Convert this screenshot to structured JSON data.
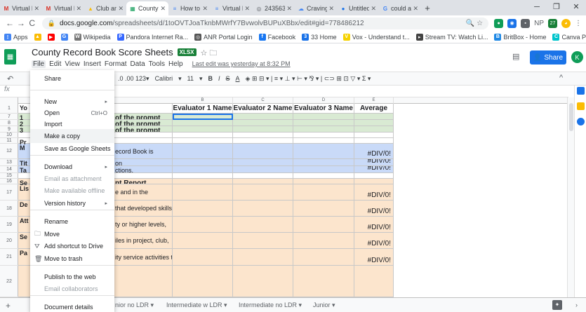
{
  "browser": {
    "tabs": [
      {
        "label": "Virtual R",
        "icon": "gmail-icon",
        "color": "#d93025",
        "glyph": "M"
      },
      {
        "label": "Virtual R",
        "icon": "gmail-icon",
        "color": "#d93025",
        "glyph": "M"
      },
      {
        "label": "Club and",
        "icon": "drive-icon",
        "color": "#fbbc04",
        "glyph": "▲"
      },
      {
        "label": "County R",
        "icon": "sheets-icon",
        "color": "#0f9d58",
        "glyph": "▦",
        "active": true
      },
      {
        "label": "How to",
        "icon": "docs-icon",
        "color": "#4285f4",
        "glyph": "≡"
      },
      {
        "label": "Virtual E",
        "icon": "docs-icon",
        "color": "#4285f4",
        "glyph": "≡"
      },
      {
        "label": "243563.",
        "icon": "globe-icon",
        "color": "#5f6368",
        "glyph": "◎"
      },
      {
        "label": "Craving",
        "icon": "cloud-icon",
        "color": "#4285f4",
        "glyph": "☁"
      },
      {
        "label": "Untitled",
        "icon": "chrome-icon",
        "color": "#1a73e8",
        "glyph": "●"
      },
      {
        "label": "could a",
        "icon": "google-icon",
        "color": "#4285f4",
        "glyph": "G"
      }
    ],
    "url_host": "docs.google.com",
    "url_path": "/spreadsheets/d/1toOVTJoaTknbMWrfY7BvwolvBUPuXBbx/edit#gid=778486212",
    "bookmarks": [
      {
        "label": "Apps",
        "color": "#4285f4",
        "glyph": "⋮"
      },
      {
        "label": "",
        "color": "#fbbc04",
        "glyph": "▲"
      },
      {
        "label": "",
        "color": "#ff0000",
        "glyph": "▶"
      },
      {
        "label": "",
        "color": "#4285f4",
        "glyph": "G"
      },
      {
        "label": "Wikipedia",
        "color": "#777777",
        "glyph": "W"
      },
      {
        "label": "Pandora Internet Ra...",
        "color": "#3668ff",
        "glyph": "P"
      },
      {
        "label": "ANR Portal Login",
        "color": "#555555",
        "glyph": "◎"
      },
      {
        "label": "Facebook",
        "color": "#1877f2",
        "glyph": "f"
      },
      {
        "label": "33 Home",
        "color": "#1a73e8",
        "glyph": "3"
      },
      {
        "label": "Vox - Understand t...",
        "color": "#f5d200",
        "glyph": "V"
      },
      {
        "label": "Stream TV: Watch Li...",
        "color": "#444444",
        "glyph": "▸"
      },
      {
        "label": "BritBox - Home",
        "color": "#1e88e5",
        "glyph": "B"
      },
      {
        "label": "Canva Pro",
        "color": "#00c4cc",
        "glyph": "C"
      }
    ],
    "ext_labels": [
      "NP",
      "27"
    ],
    "more_bookmarks": "»"
  },
  "sheets": {
    "title": "County Record Book Score Sheets",
    "badge": "XLSX",
    "menu": [
      "File",
      "Edit",
      "View",
      "Insert",
      "Format",
      "Data",
      "Tools",
      "Help"
    ],
    "last_edit": "Last edit was yesterday at 8:32 PM",
    "share_label": "Share",
    "avatar": "K"
  },
  "toolbar": {
    "decimals": ".0  .00  123▾",
    "font": "Calibri",
    "font_caret": "▾",
    "size": "11",
    "size_caret": "▾",
    "bold": "B",
    "italic": "I",
    "strike": "S",
    "textcolor": "A",
    "rest": "◈  ⊞  ⊟ ▾  |  ≡ ▾  ⊥ ▾  ⊢ ▾  ⅋ ▾  |  ⊂⊃  ⊞  ⊡  ▽ ▾  Σ ▾"
  },
  "formula": {
    "fx": "fx"
  },
  "grid": {
    "col_letters": [
      "B",
      "C",
      "D",
      "E"
    ],
    "headers": [
      "Evaluator 1 Name",
      "Evaluator 2 Name",
      "Evaluator 3 Name",
      "Average"
    ],
    "row_numbers": [
      "1",
      "7",
      "8",
      "9",
      "10",
      "11",
      "12",
      "13",
      "14",
      "15",
      "16",
      "17",
      "18",
      "19",
      "20",
      "21",
      "22"
    ],
    "left_cells": [
      "Yo",
      "1",
      "2",
      "3",
      "Pr",
      "M",
      "Tit",
      "Ta",
      "Se",
      "Lis",
      "De",
      "Att",
      "Se",
      "Pa"
    ],
    "partial_a": [
      "of the prompt",
      "of the prompt",
      "of the prompt",
      "ecord Book is",
      "on",
      "ctions.",
      "nt Report",
      "e and in the",
      "that developed skills",
      "ty or higher levels,",
      "iles in project, club,",
      "ity service activities to"
    ],
    "div0": "#DIV/0!"
  },
  "filemenu": {
    "items": [
      {
        "label": "Share",
        "enabled": true
      },
      {
        "label": "New",
        "enabled": true,
        "submenu": true
      },
      {
        "label": "Open",
        "enabled": true,
        "shortcut": "Ctrl+O"
      },
      {
        "label": "Import",
        "enabled": true
      },
      {
        "label": "Make a copy",
        "enabled": true
      },
      {
        "label": "Save as Google Sheets",
        "enabled": true
      },
      {
        "label": "Download",
        "enabled": true,
        "submenu": true
      },
      {
        "label": "Email as attachment",
        "enabled": false
      },
      {
        "label": "Make available offline",
        "enabled": false
      },
      {
        "label": "Version history",
        "enabled": true,
        "submenu": true
      },
      {
        "label": "Rename",
        "enabled": true
      },
      {
        "label": "Move",
        "enabled": true,
        "icon": "folder-icon"
      },
      {
        "label": "Add shortcut to Drive",
        "enabled": true,
        "icon": "drive-shortcut-icon"
      },
      {
        "label": "Move to trash",
        "enabled": true,
        "icon": "trash-icon"
      },
      {
        "label": "Publish to the web",
        "enabled": true
      },
      {
        "label": "Email collaborators",
        "enabled": false
      },
      {
        "label": "Document details",
        "enabled": true
      }
    ]
  },
  "sheettabs": {
    "tabs": [
      "nior no LDR ▾",
      "Intermediate w LDR ▾",
      "Intermediate no LDR ▾",
      "Junior ▾"
    ],
    "more": "›"
  },
  "colors": {
    "sheets_green": "#0f9d58",
    "share_blue": "#1a73e8",
    "green_fill": "#d9ead3",
    "blue_fill": "#c9daf8",
    "peach_fill": "#fce5cd"
  }
}
